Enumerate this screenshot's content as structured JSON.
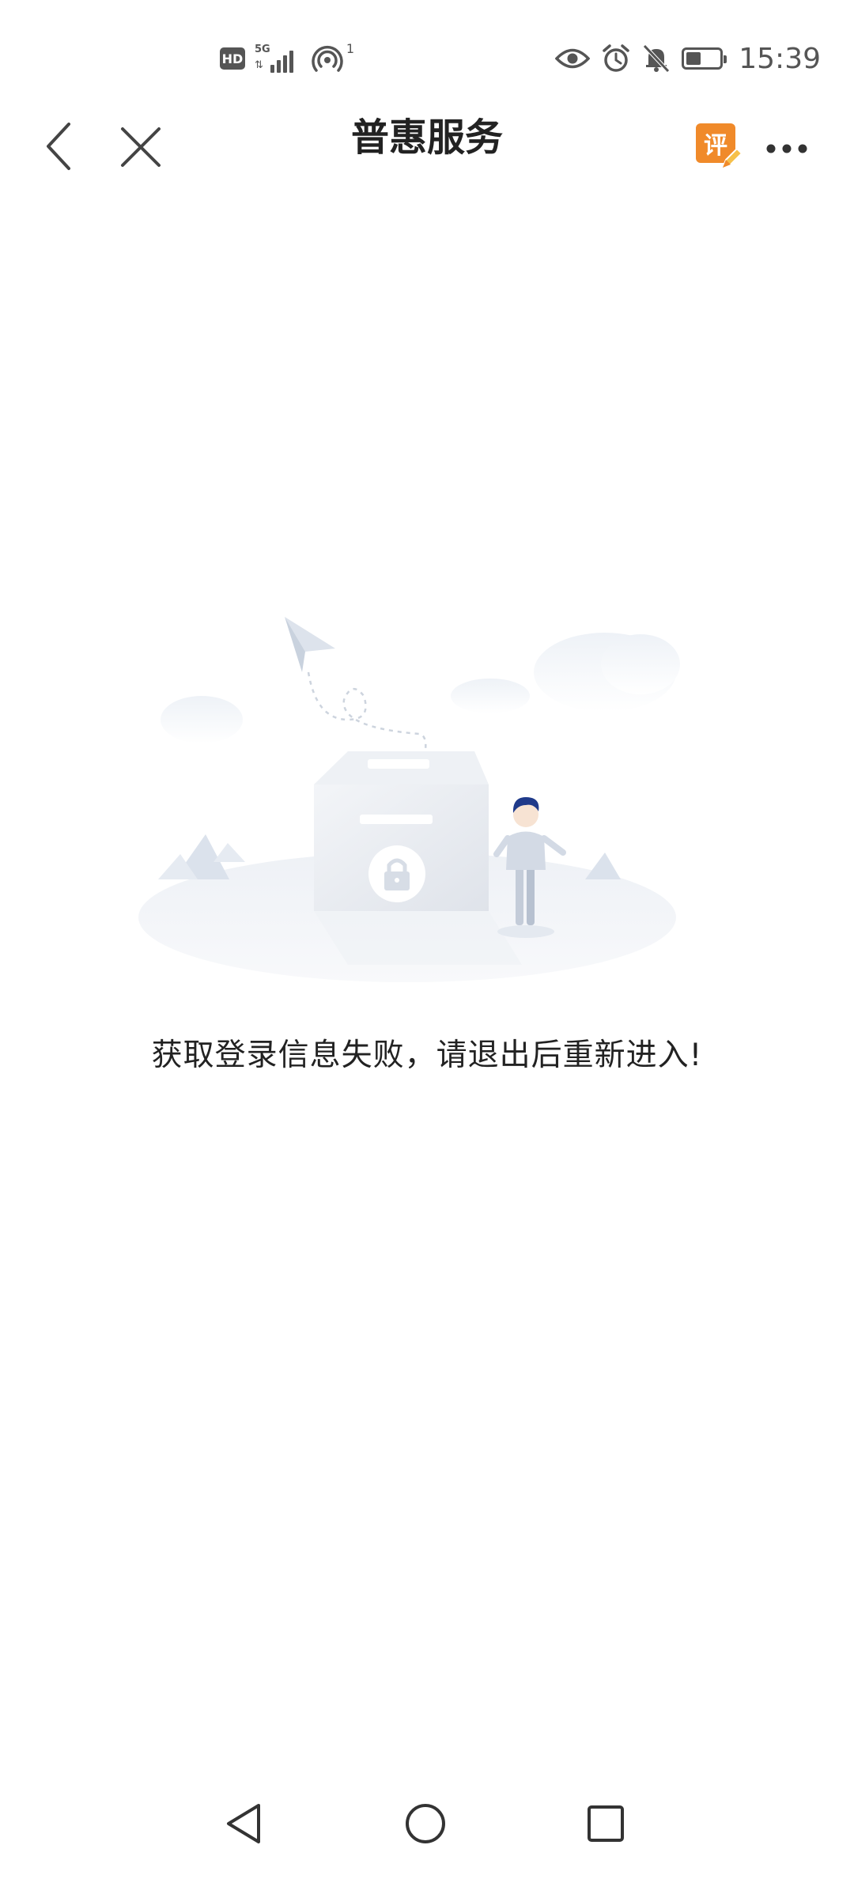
{
  "status_bar": {
    "network_type": "HD",
    "signal_generation": "5G",
    "data_arrows": "⇅",
    "hotspot_count": "1",
    "time": "15:39",
    "battery_level": 0.45,
    "icons": [
      "hd-icon",
      "signal-icon",
      "hotspot-icon",
      "eye-icon",
      "alarm-icon",
      "mute-bell-icon",
      "battery-icon"
    ]
  },
  "nav": {
    "title": "普惠服务",
    "back_icon": "chevron-left-icon",
    "close_icon": "close-icon",
    "rate_badge": "评",
    "more_icon": "more-dots-icon"
  },
  "content": {
    "illustration": "locked-box-illustration",
    "message": "获取登录信息失败，请退出后重新进入!"
  },
  "system_nav": {
    "back_icon": "triangle-back-icon",
    "home_icon": "circle-home-icon",
    "recents_icon": "square-recents-icon"
  },
  "colors": {
    "accent": "#f08a2a",
    "text": "#222222",
    "icon_gray": "#555555",
    "illustration_base": "#e9edf3"
  }
}
